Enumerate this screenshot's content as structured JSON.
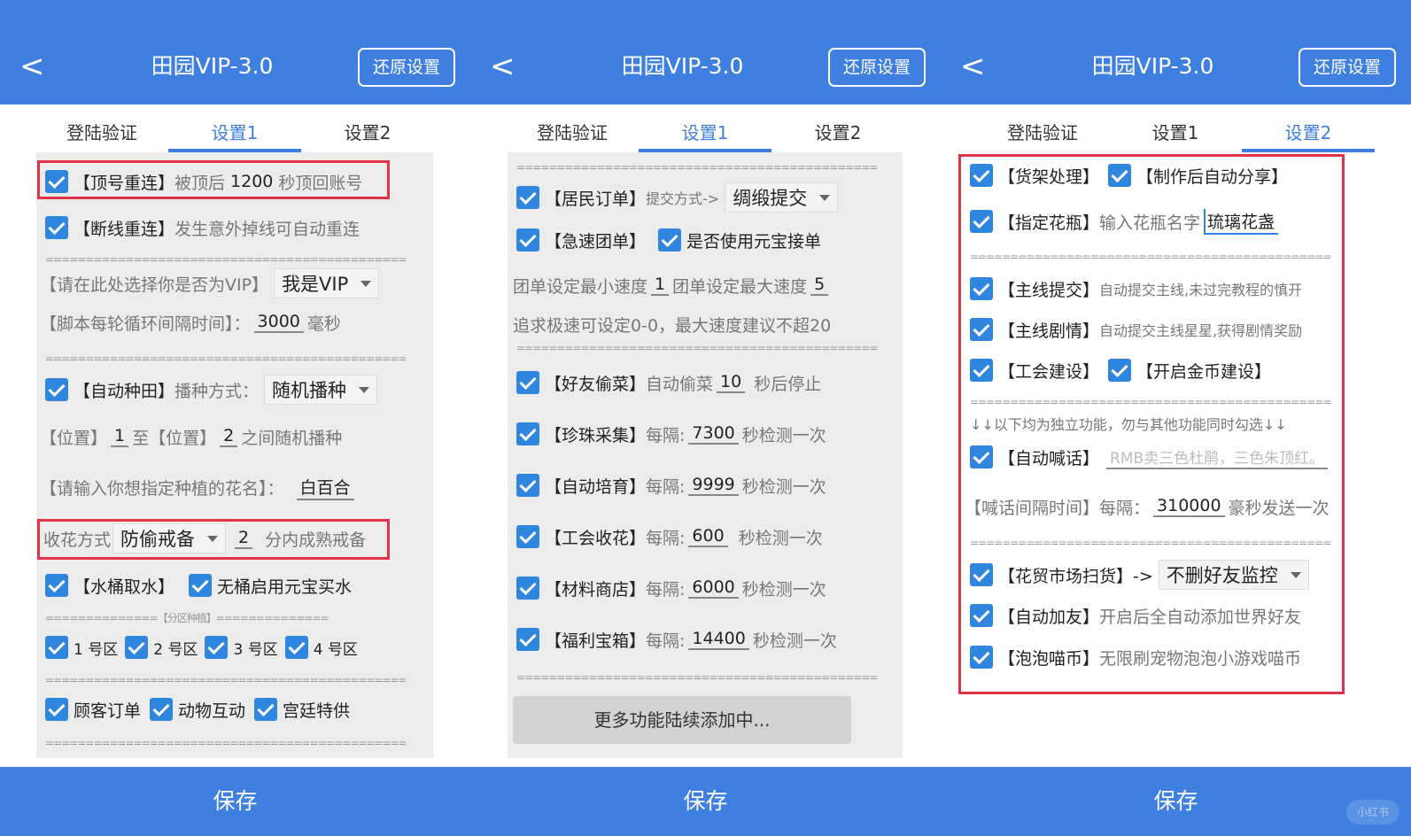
{
  "header": {
    "title": "田园VIP-3.0",
    "restore_label": "还原设置",
    "back_glyph": "<"
  },
  "tabs": [
    "登陆验证",
    "设置1",
    "设置2"
  ],
  "footer": {
    "save_label": "保存"
  },
  "colors": {
    "brand": "#3e7fe0",
    "checkbox": "#2f86de",
    "highlight": "#e0334a",
    "panel_bg": "#ececec"
  },
  "icons": {
    "back": "chevron-left-icon",
    "check": "checkmark-icon",
    "dropdown": "caret-down-icon"
  },
  "separator": "=============================================",
  "panel1": {
    "active_tab": 1,
    "dinghao": {
      "label": "【顶号重连】",
      "desc_pre": "被顶后",
      "seconds": "1200",
      "desc_post": "秒顶回账号"
    },
    "duanxian": {
      "label": "【断线重连】",
      "desc": "发生意外掉线可自动重连"
    },
    "vip_prompt": "【请在此处选择你是否为VIP】",
    "vip_value": "我是VIP",
    "interval_label": "【脚本每轮循环间隔时间】：",
    "interval_value": "3000",
    "interval_unit": "毫秒",
    "zhongtian": {
      "label": "【自动种田】",
      "mode_label": "播种方式：",
      "mode_value": "随机播种"
    },
    "position": {
      "a": "【位置】",
      "from": "1",
      "to_label": "至【位置】",
      "to": "2",
      "suffix": "之间随机播种"
    },
    "flower_prompt": "【请输入你想指定种植的花名】：",
    "flower_value": "白百合",
    "harvest": {
      "label": "收花方式",
      "value": "防偷戒备",
      "minutes": "2",
      "suffix": "分内成熟戒备"
    },
    "water": {
      "label": "【水桶取水】",
      "extra": "无桶启用元宝买水"
    },
    "zone_sep": "==============【分区种植】==============",
    "zones": [
      "1 号区",
      "2 号区",
      "3 号区",
      "4 号区"
    ],
    "bottom": [
      "顾客订单",
      "动物互动",
      "宫廷特供"
    ]
  },
  "panel2": {
    "active_tab": 1,
    "jumin": {
      "label": "【居民订单】",
      "submit_label": "提交方式->",
      "submit_value": "绸缎提交"
    },
    "jisu": {
      "label": "【急速团单】",
      "extra": "是否使用元宝接单"
    },
    "speed": {
      "min_label": "团单设定最小速度",
      "min": "1",
      "max_label": "团单设定最大速度",
      "max": "5"
    },
    "speed_note": "追求极速可设定0-0，最大速度建议不超20",
    "items": [
      {
        "label": "【好友偷菜】",
        "pre": "自动偷菜",
        "value": "10",
        "post": "秒后停止"
      },
      {
        "label": "【珍珠采集】",
        "pre": "每隔:",
        "value": "7300",
        "post": "秒检测一次"
      },
      {
        "label": "【自动培育】",
        "pre": "每隔:",
        "value": "9999",
        "post": "秒检测一次"
      },
      {
        "label": "【工会收花】",
        "pre": "每隔:",
        "value": "600",
        "post": "秒检测一次"
      },
      {
        "label": "【材料商店】",
        "pre": "每隔:",
        "value": "6000",
        "post": "秒检测一次"
      },
      {
        "label": "【福利宝箱】",
        "pre": "每隔:",
        "value": "14400",
        "post": "秒检测一次"
      }
    ],
    "more_label": "更多功能陆续添加中..."
  },
  "panel3": {
    "active_tab": 2,
    "huojia": {
      "label": "【货架处理】",
      "extra": "【制作后自动分享】"
    },
    "huaping": {
      "label": "【指定花瓶】",
      "prompt": "输入花瓶名字",
      "value": "琉璃花盏"
    },
    "zhuxian": {
      "label": "【主线提交】",
      "desc": "自动提交主线,未过完教程的慎开"
    },
    "juqing": {
      "label": "【主线剧情】",
      "desc": "自动提交主线星星,获得剧情奖励"
    },
    "gonghui": {
      "label": "【工会建设】",
      "extra": "【开启金币建设】"
    },
    "independent_note": "↓↓以下均为独立功能，勿与其他功能同时勾选↓↓",
    "hanhua": {
      "label": "【自动喊话】",
      "placeholder": "RMB卖三色杜鹃，三色朱顶红。"
    },
    "hanhua_interval": {
      "label": "【喊话间隔时间】每隔：",
      "value": "310000",
      "suffix": "豪秒发送一次"
    },
    "huamao": {
      "label": "【花贸市场扫货】->",
      "value": "不删好友监控"
    },
    "jiayou": {
      "label": "【自动加友】",
      "desc": "开启后全自动添加世界好友"
    },
    "paopao": {
      "label": "【泡泡喵币】",
      "desc": "无限刷宠物泡泡小游戏喵币"
    }
  },
  "watermark": "小红书"
}
